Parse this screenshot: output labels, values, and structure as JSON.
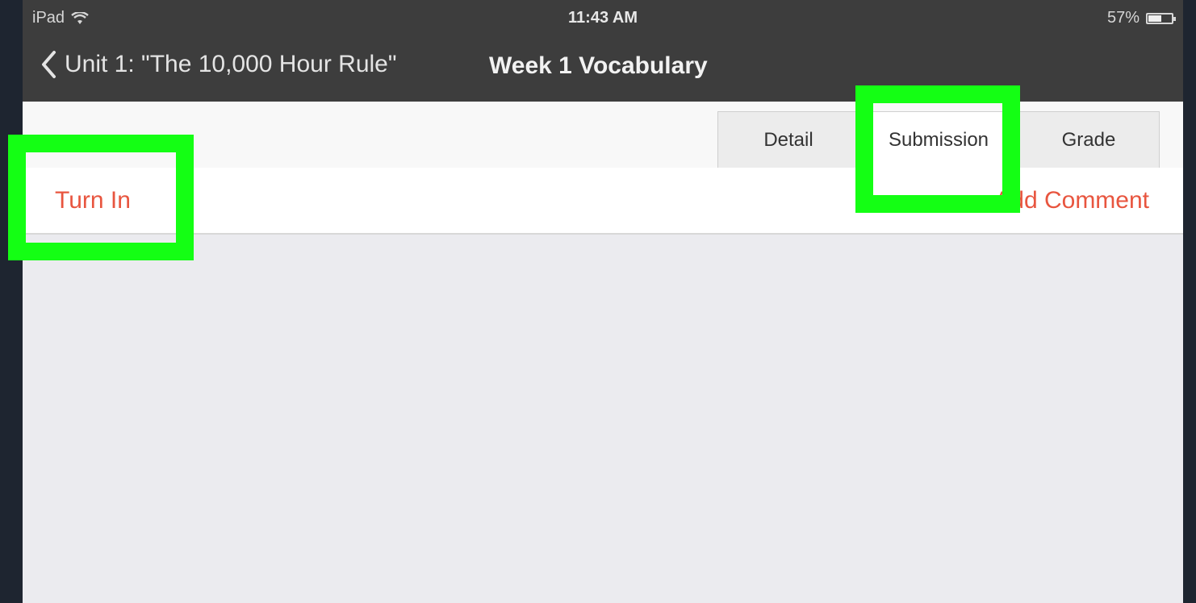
{
  "status": {
    "device": "iPad",
    "time": "11:43 AM",
    "battery": "57%",
    "battery_level": 0.57
  },
  "nav": {
    "back_label": "Unit 1: \"The 10,000 Hour Rule\"",
    "title": "Week 1 Vocabulary"
  },
  "tabs": [
    {
      "label": "Detail",
      "active": false
    },
    {
      "label": "Submission",
      "active": true
    },
    {
      "label": "Grade",
      "active": false
    }
  ],
  "actions": {
    "turn_in": "Turn In",
    "add_comment": "Add Comment"
  },
  "colors": {
    "accent": "#e8553f",
    "highlight": "#14ff14",
    "nav_bg": "#3d3d3d"
  }
}
